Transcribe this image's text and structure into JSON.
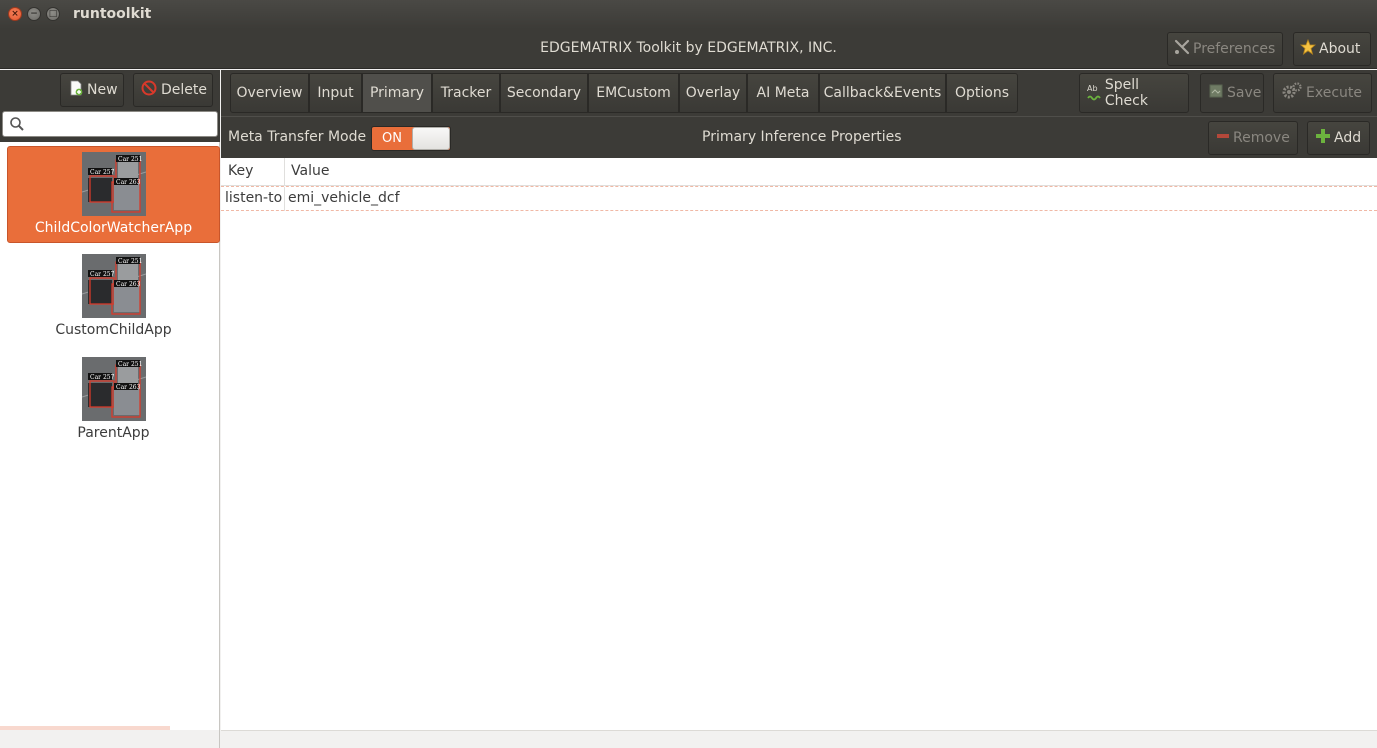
{
  "window": {
    "title": "runtoolkit"
  },
  "header": {
    "title": "EDGEMATRIX Toolkit by EDGEMATRIX, INC.",
    "preferences_label": "Preferences",
    "about_label": "About"
  },
  "sidebar": {
    "new_label": "New",
    "delete_label": "Delete",
    "search_placeholder": "",
    "apps": [
      {
        "label": "ChildColorWatcherApp",
        "selected": true
      },
      {
        "label": "CustomChildApp",
        "selected": false
      },
      {
        "label": "ParentApp",
        "selected": false
      }
    ],
    "thumb_labels": [
      "Car 251",
      "Car 257",
      "Car 263"
    ]
  },
  "tabs": [
    "Overview",
    "Input",
    "Primary",
    "Tracker",
    "Secondary",
    "EMCustom",
    "Overlay",
    "AI Meta",
    "Callback&Events",
    "Options"
  ],
  "active_tab": "Primary",
  "toolbar": {
    "spell_check_label": "Spell Check",
    "spell_icon_text": "Ab",
    "save_label": "Save",
    "execute_label": "Execute"
  },
  "properties": {
    "meta_transfer_label": "Meta Transfer Mode",
    "switch_state": "ON",
    "title": "Primary Inference Properties",
    "remove_label": "Remove",
    "add_label": "Add"
  },
  "table": {
    "columns": [
      "Key",
      "Value"
    ],
    "rows": [
      {
        "key": "listen-to",
        "value": "emi_vehicle_dcf"
      }
    ]
  },
  "colors": {
    "accent": "#e96e3a",
    "chrome": "#3c3b37"
  }
}
